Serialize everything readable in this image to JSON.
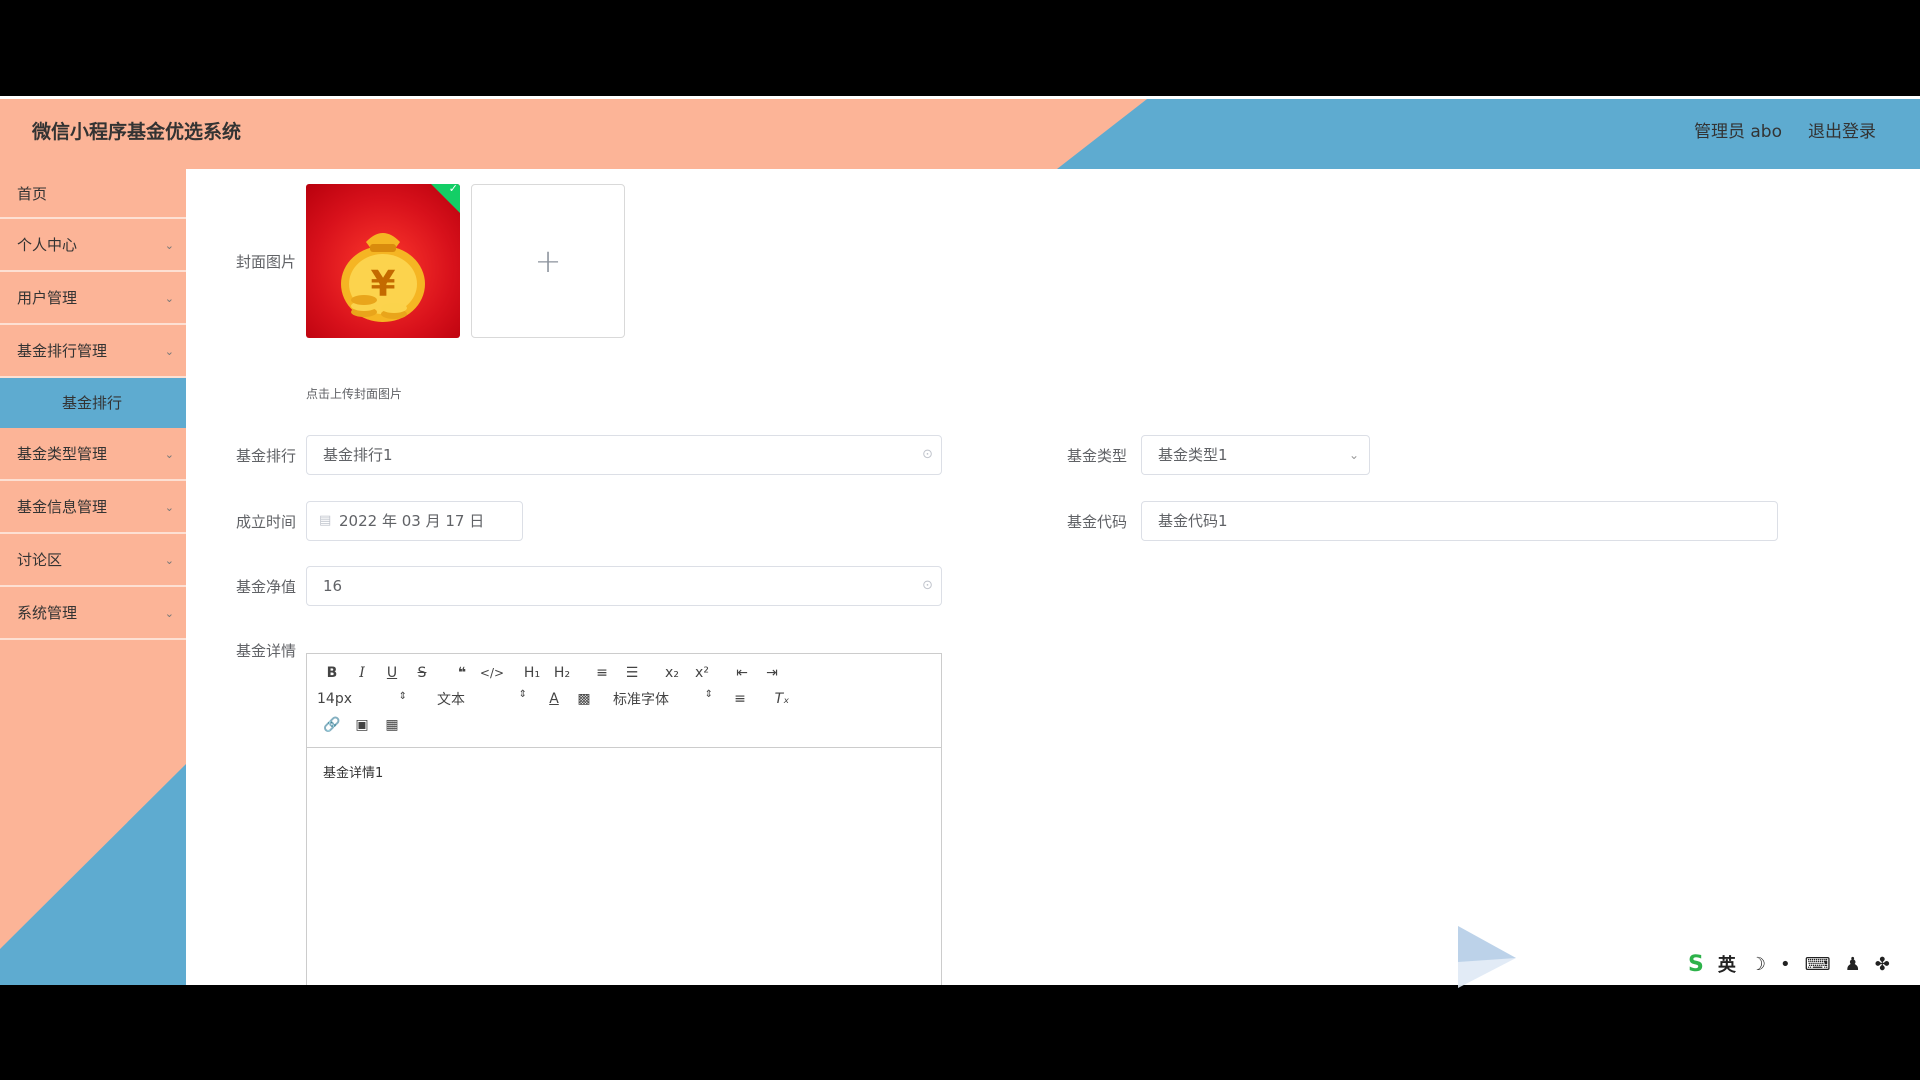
{
  "header": {
    "title": "微信小程序基金优选系统",
    "user": "管理员 abo",
    "logout": "退出登录"
  },
  "sidebar": {
    "items": [
      {
        "label": "首页"
      },
      {
        "label": "个人中心"
      },
      {
        "label": "用户管理"
      },
      {
        "label": "基金排行管理"
      },
      {
        "label": "基金类型管理"
      },
      {
        "label": "基金信息管理"
      },
      {
        "label": "讨论区"
      },
      {
        "label": "系统管理"
      }
    ],
    "sub_active": "基金排行"
  },
  "form": {
    "cover_label": "封面图片",
    "cover_hint": "点击上传封面图片",
    "rank_label": "基金排行",
    "rank_value": "基金排行1",
    "type_label": "基金类型",
    "type_value": "基金类型1",
    "date_label": "成立时间",
    "date_value": "2022 年 03 月 17 日",
    "code_label": "基金代码",
    "code_value": "基金代码1",
    "nav_label": "基金净值",
    "nav_value": "16",
    "detail_label": "基金详情",
    "detail_value": "基金详情1"
  },
  "editor": {
    "size_value": "14px",
    "header_value": "文本",
    "font_value": "标准字体"
  },
  "ime": {
    "lang": "英"
  }
}
